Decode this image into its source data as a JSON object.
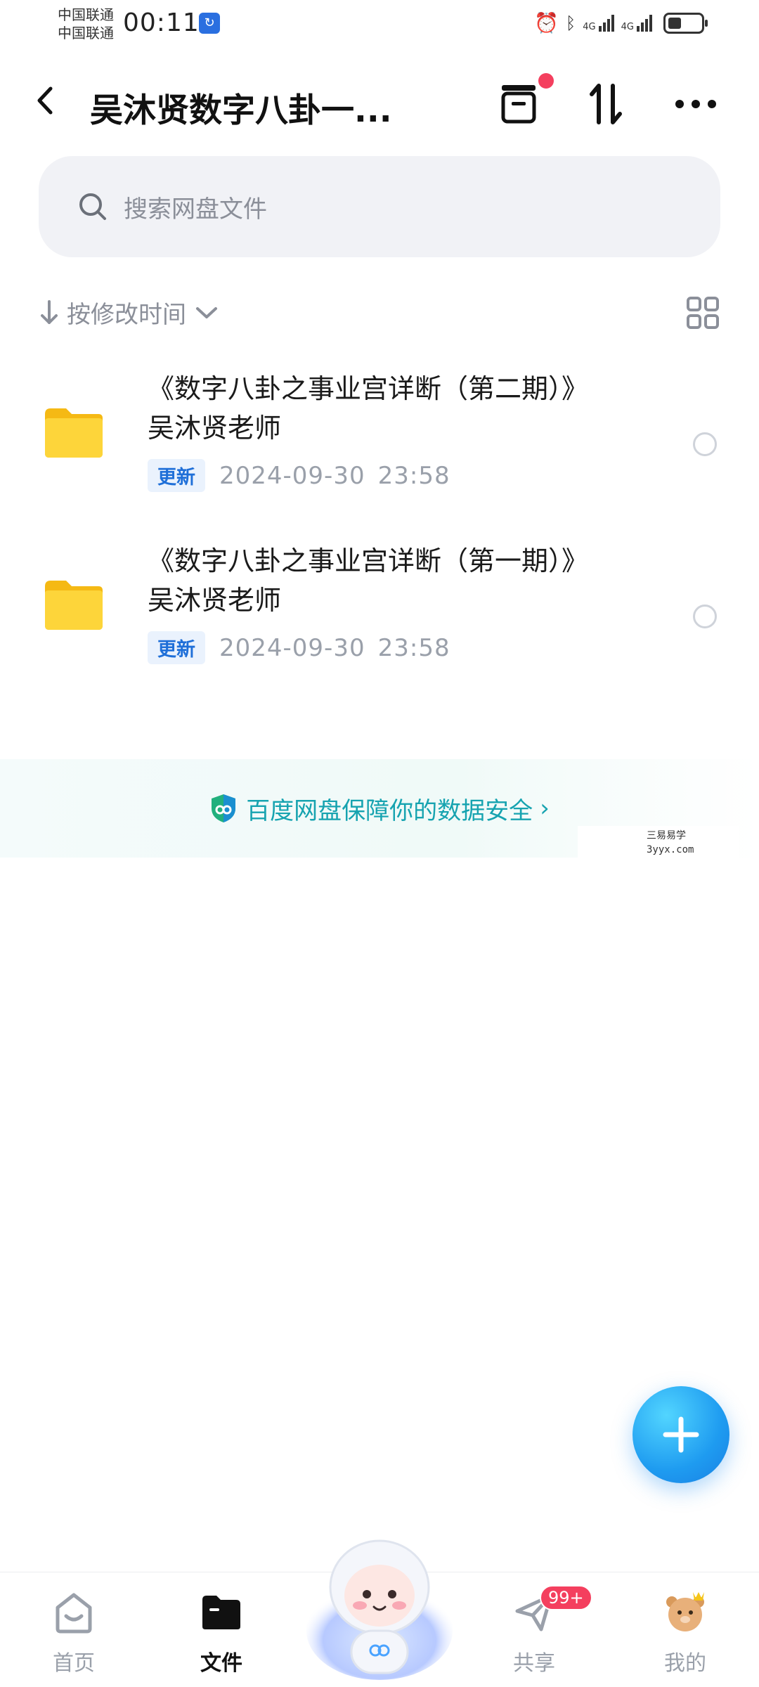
{
  "status_bar": {
    "carrier_1": "中国联通",
    "carrier_2": "中国联通",
    "time": "00:11",
    "network_1": "4G",
    "network_2": "4G",
    "battery_percent": 40
  },
  "header": {
    "title": "吴沐贤数字八卦一...",
    "has_notification_dot": true
  },
  "search": {
    "placeholder": "搜索网盘文件"
  },
  "sort": {
    "label": "按修改时间"
  },
  "files": [
    {
      "name": "《数字八卦之事业宫详断（第二期）》吴沐贤老师",
      "tag": "更新",
      "date": "2024-09-30",
      "time": "23:58"
    },
    {
      "name": "《数字八卦之事业宫详断（第一期）》吴沐贤老师",
      "tag": "更新",
      "date": "2024-09-30",
      "time": "23:58"
    }
  ],
  "banner": {
    "text": "百度网盘保障你的数据安全"
  },
  "watermark": {
    "line1": "三易易学",
    "line2": "3yyx.com"
  },
  "bottom_nav": {
    "items": [
      {
        "label": "首页"
      },
      {
        "label": "文件"
      },
      {
        "label": "共享",
        "badge": "99+"
      },
      {
        "label": "我的"
      }
    ]
  },
  "colors": {
    "accent_blue": "#1f6fd8",
    "teal": "#16a3b0",
    "badge_red": "#f43f5e",
    "folder_yellow": "#fcd34d"
  }
}
